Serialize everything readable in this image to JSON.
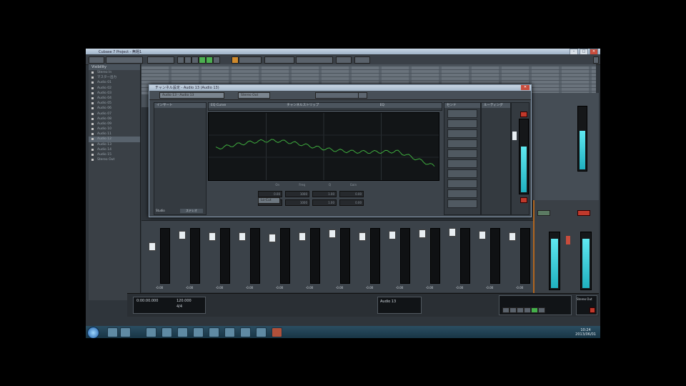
{
  "window": {
    "title": "Cubase 7 Project - 無題1",
    "min_glyph": "–",
    "max_glyph": "□",
    "close_glyph": "✕"
  },
  "left_panel": {
    "header": "Visibility",
    "items": [
      "Stereo In",
      "マスター出力",
      "Audio 01",
      "Audio 02",
      "Audio 03",
      "Audio 04",
      "Audio 05",
      "Audio 06",
      "Audio 07",
      "Audio 08",
      "Audio 09",
      "Audio 10",
      "Audio 11",
      "Audio 12",
      "Audio 13",
      "Audio 14",
      "Audio 15",
      "Stereo Out"
    ],
    "selected_index": 13
  },
  "dialog": {
    "title": "チャンネル設定 - Audio 13 (Audio 13)",
    "preset_field": "Audio 13 - Audio 13",
    "routing_field": "Stereo Out",
    "insert_header": "インサート",
    "eq_header": "チャンネルストリップ",
    "eq_tab": "EQ",
    "sends_header": "センド",
    "right_header": "ルーティング",
    "bypass_label": "EQ Curve",
    "lowcut_label": "Lo-Cut",
    "footer_left": "Studio",
    "footer_right": "ステレオ",
    "param_labels": [
      "On",
      "Freq",
      "Q",
      "Gain"
    ],
    "param_values": [
      "0.00",
      "1000",
      "1.00",
      "0.00"
    ]
  },
  "mixer": {
    "labels": [
      "-0.00",
      "-0.00",
      "-0.00",
      "-0.00",
      "-0.00",
      "-0.00",
      "-0.00",
      "-0.00",
      "-0.00",
      "-0.00",
      "-0.00",
      "-0.00",
      "-0.00"
    ]
  },
  "transport": {
    "time_display": "0:00:00.000",
    "tempo": "120.000",
    "signature": "4/4",
    "tracks": "Audio 13",
    "status": "Stereo Out"
  },
  "taskbar": {
    "time": "10:24",
    "date": "2013/06/01"
  },
  "colors": {
    "meter": "#2fc4d3",
    "accent_orange": "#b0651f",
    "record_red": "#d04238",
    "play_green": "#44b04a"
  }
}
